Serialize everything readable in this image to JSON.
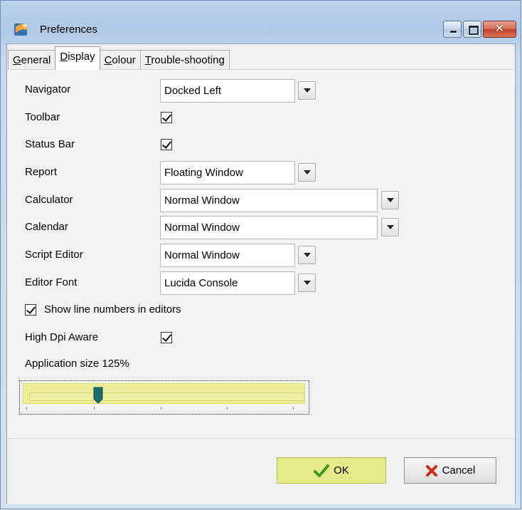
{
  "window": {
    "title": "Preferences"
  },
  "tabs": [
    {
      "label": "General",
      "accel_index": 0,
      "active": false
    },
    {
      "label": "Display",
      "accel_index": 0,
      "active": true
    },
    {
      "label": "Colour",
      "accel_index": 0,
      "active": false
    },
    {
      "label": "Trouble-shooting",
      "accel_index": 0,
      "active": false
    }
  ],
  "display": {
    "navigator": {
      "label": "Navigator",
      "value": "Docked Left"
    },
    "toolbar": {
      "label": "Toolbar",
      "checked": true
    },
    "status_bar": {
      "label": "Status Bar",
      "checked": true
    },
    "report": {
      "label": "Report",
      "value": "Floating Window"
    },
    "calculator": {
      "label": "Calculator",
      "value": "Normal Window"
    },
    "calendar": {
      "label": "Calendar",
      "value": "Normal Window"
    },
    "script_editor": {
      "label": "Script Editor",
      "value": "Normal Window"
    },
    "editor_font": {
      "label": "Editor Font",
      "value": "Lucida Console"
    },
    "show_line_numbers": {
      "label": "Show line numbers in editors",
      "checked": true
    },
    "high_dpi": {
      "label": "High Dpi Aware",
      "checked": true
    },
    "app_size": {
      "label": "Application size 125%",
      "value_percent": 125,
      "position_fraction": 0.27
    }
  },
  "buttons": {
    "ok": "OK",
    "cancel": "Cancel"
  },
  "colors": {
    "accent_yellow": "#e6eb8a",
    "thumb_teal": "#1b6e6a",
    "ok_green": "#3a9a1e",
    "cancel_red": "#d12a1a"
  },
  "icons": [
    "app-icon",
    "minimize-icon",
    "maximize-icon",
    "close-icon",
    "check-icon",
    "dropdown-arrow-icon",
    "ok-checkmark-icon",
    "cancel-x-icon"
  ]
}
